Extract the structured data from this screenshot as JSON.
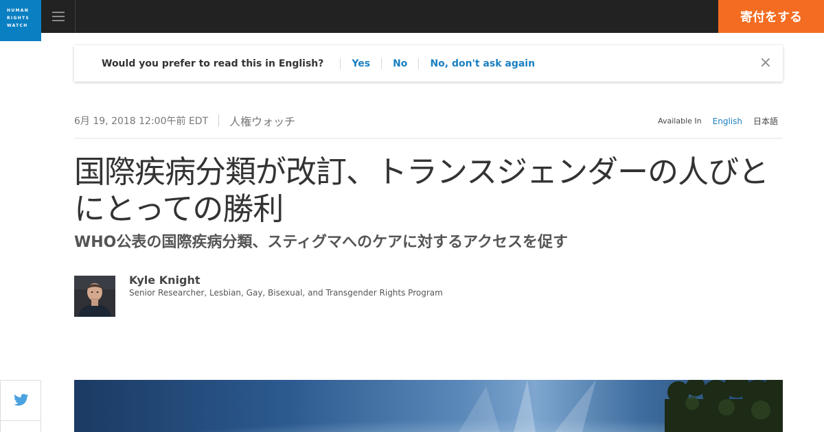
{
  "header": {
    "logo_lines": [
      "HUMAN",
      "RIGHTS",
      "WATCH"
    ],
    "donate_label": "寄付をする"
  },
  "language_banner": {
    "question": "Would you prefer to read this in English?",
    "options": [
      "Yes",
      "No",
      "No, don't ask again"
    ],
    "close_glyph": "×"
  },
  "article": {
    "date": "6月 19, 2018 12:00午前 EDT",
    "source": "人権ウォッチ",
    "available_in": {
      "label": "Available In",
      "languages": [
        "English",
        "日本語"
      ]
    },
    "title": "国際疾病分類が改訂、トランスジェンダーの人びとにとっての勝利",
    "subtitle": "WHO公表の国際疾病分類、スティグマへのケアに対するアクセスを促す",
    "author": {
      "name": "Kyle Knight",
      "role": "Senior Researcher, Lesbian, Gay, Bisexual, and Transgender Rights Program"
    }
  },
  "share": {
    "twitter_icon": "twitter-bird-icon"
  },
  "colors": {
    "topbar": "#222222",
    "logo_blue": "#0a7fc2",
    "donate_orange": "#f36c21",
    "link_blue": "#1a7fc1"
  }
}
